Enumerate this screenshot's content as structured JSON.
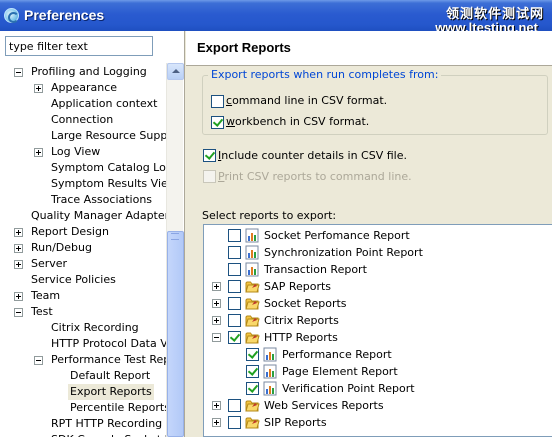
{
  "window": {
    "title": "Preferences",
    "watermark_cn": "领测软件测试网",
    "watermark_url": "www.ltesting.net"
  },
  "filter": {
    "value": "type filter text"
  },
  "nav_tree": [
    {
      "label": "Profiling and Logging",
      "level": 1,
      "expander": "minus"
    },
    {
      "label": "Appearance",
      "level": 2,
      "expander": "plus"
    },
    {
      "label": "Application context",
      "level": 2,
      "expander": null
    },
    {
      "label": "Connection",
      "level": 2,
      "expander": null
    },
    {
      "label": "Large Resource Support",
      "level": 2,
      "expander": null
    },
    {
      "label": "Log View",
      "level": 2,
      "expander": "plus"
    },
    {
      "label": "Symptom Catalog Location",
      "level": 2,
      "expander": null
    },
    {
      "label": "Symptom Results View",
      "level": 2,
      "expander": null
    },
    {
      "label": "Trace Associations",
      "level": 2,
      "expander": null
    },
    {
      "label": "Quality Manager Adapter",
      "level": 1,
      "expander": null
    },
    {
      "label": "Report Design",
      "level": 1,
      "expander": "plus"
    },
    {
      "label": "Run/Debug",
      "level": 1,
      "expander": "plus"
    },
    {
      "label": "Server",
      "level": 1,
      "expander": "plus"
    },
    {
      "label": "Service Policies",
      "level": 1,
      "expander": null
    },
    {
      "label": "Team",
      "level": 1,
      "expander": "plus"
    },
    {
      "label": "Test",
      "level": 1,
      "expander": "minus"
    },
    {
      "label": "Citrix Recording",
      "level": 2,
      "expander": null
    },
    {
      "label": "HTTP Protocol Data View",
      "level": 2,
      "expander": null
    },
    {
      "label": "Performance Test Reports",
      "level": 2,
      "expander": "minus"
    },
    {
      "label": "Default Report",
      "level": 3,
      "expander": null
    },
    {
      "label": "Export Reports",
      "level": 3,
      "expander": null,
      "selected": true
    },
    {
      "label": "Percentile Reports",
      "level": 3,
      "expander": null
    },
    {
      "label": "RPT HTTP Recording",
      "level": 2,
      "expander": null
    },
    {
      "label": "SDK Console Socket Recording",
      "level": 2,
      "expander": null
    }
  ],
  "page": {
    "title": "Export Reports",
    "run_group_label": "Export reports when run completes from:",
    "opt_cmdline": {
      "mnemonic": "c",
      "rest": "ommand line in CSV format.",
      "checked": false
    },
    "opt_workbench": {
      "mnemonic": "w",
      "rest": "orkbench in CSV format.",
      "checked": true
    },
    "opt_counter": {
      "mnemonic": "I",
      "rest": "nclude counter details in CSV file.",
      "checked": true
    },
    "opt_print": {
      "mnemonic": "P",
      "rest": "rint CSV reports to command line.",
      "checked": false,
      "disabled": true
    },
    "select_label": "Select reports to export:"
  },
  "reports": [
    {
      "label": "Socket Perfomance Report",
      "level": 0,
      "expander": null,
      "checked": false,
      "icon": "chart-icon"
    },
    {
      "label": "Synchronization Point Report",
      "level": 0,
      "expander": null,
      "checked": false,
      "icon": "chart-icon"
    },
    {
      "label": "Transaction Report",
      "level": 0,
      "expander": null,
      "checked": false,
      "icon": "chart-icon"
    },
    {
      "label": "SAP Reports",
      "level": 0,
      "expander": "plus",
      "checked": false,
      "icon": "folder-icon"
    },
    {
      "label": "Socket Reports",
      "level": 0,
      "expander": "plus",
      "checked": false,
      "icon": "folder-icon"
    },
    {
      "label": "Citrix Reports",
      "level": 0,
      "expander": "plus",
      "checked": false,
      "icon": "folder-icon"
    },
    {
      "label": "HTTP Reports",
      "level": 0,
      "expander": "minus",
      "checked": true,
      "icon": "folder-icon"
    },
    {
      "label": "Performance Report",
      "level": 1,
      "expander": null,
      "checked": true,
      "icon": "chart-icon"
    },
    {
      "label": "Page Element Report",
      "level": 1,
      "expander": null,
      "checked": true,
      "icon": "chart-icon"
    },
    {
      "label": "Verification Point Report",
      "level": 1,
      "expander": null,
      "checked": true,
      "icon": "chart-icon"
    },
    {
      "label": "Web Services Reports",
      "level": 0,
      "expander": "plus",
      "checked": false,
      "icon": "folder-icon"
    },
    {
      "label": "SIP Reports",
      "level": 0,
      "expander": "plus",
      "checked": false,
      "icon": "folder-icon"
    }
  ],
  "colors": {
    "titlebar": "#2557cc",
    "group_label": "#0046d5",
    "check": "#21a121"
  }
}
